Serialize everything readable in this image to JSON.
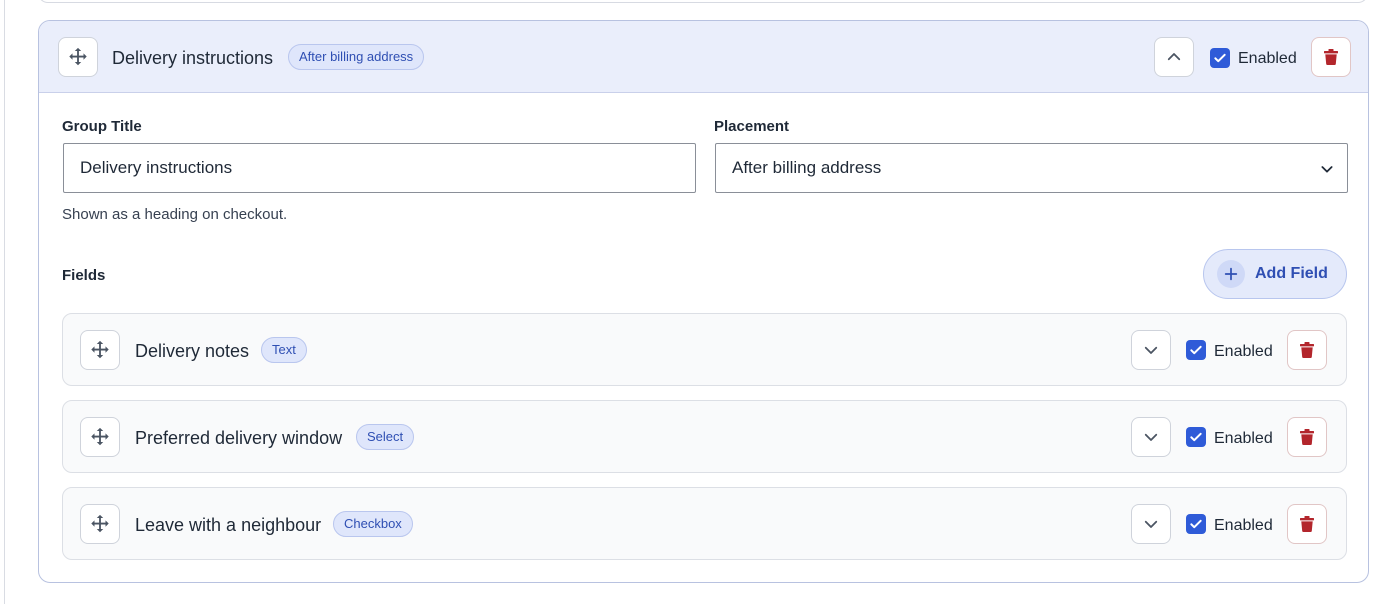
{
  "group": {
    "title": "Delivery instructions",
    "placement_badge": "After billing address",
    "enabled_label": "Enabled",
    "enabled": true,
    "expanded": true,
    "form": {
      "group_title_label": "Group Title",
      "group_title_value": "Delivery instructions",
      "group_title_help": "Shown as a heading on checkout.",
      "placement_label": "Placement",
      "placement_value": "After billing address"
    },
    "fields_label": "Fields",
    "add_field_label": "Add Field",
    "fields": [
      {
        "title": "Delivery notes",
        "type": "Text",
        "enabled_label": "Enabled",
        "enabled": true
      },
      {
        "title": "Preferred delivery window",
        "type": "Select",
        "enabled_label": "Enabled",
        "enabled": true
      },
      {
        "title": "Leave with a neighbour",
        "type": "Checkbox",
        "enabled_label": "Enabled",
        "enabled": true
      }
    ]
  },
  "colors": {
    "accent": "#2f5bd8",
    "header_bg": "#eaeefb",
    "badge_bg": "#dfe6fb",
    "badge_text": "#2f4fb3",
    "danger": "#b3262c"
  },
  "icons": {
    "drag": "move-icon",
    "collapse": "chevron-up-icon",
    "expand": "chevron-down-icon",
    "delete": "trash-icon",
    "checkbox": "checkmark-icon",
    "add": "plus-icon",
    "select": "chevron-down-icon"
  }
}
